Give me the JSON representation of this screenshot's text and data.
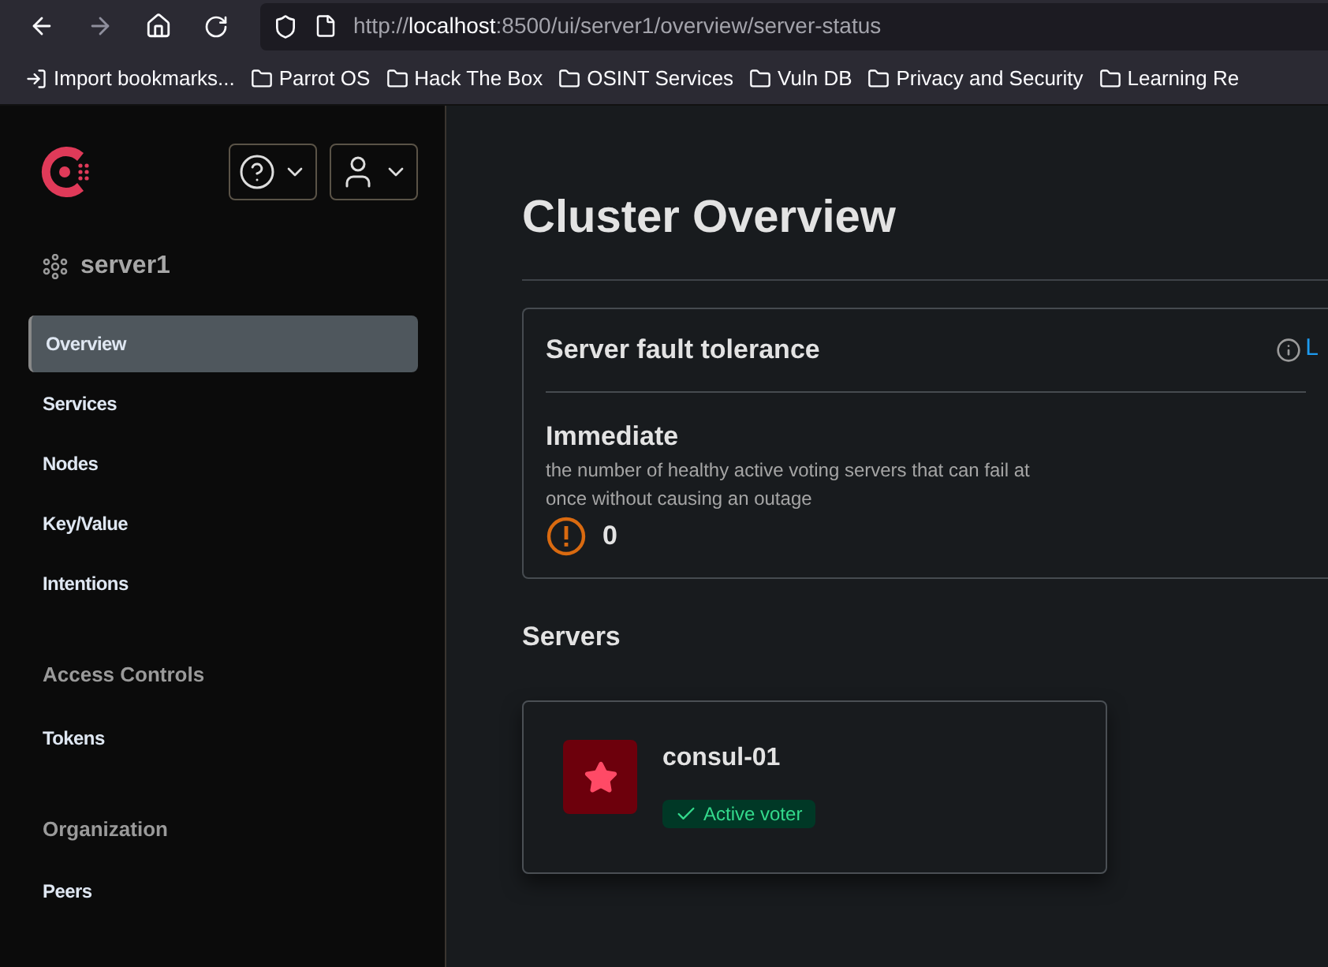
{
  "browser": {
    "url": {
      "scheme": "http://",
      "host": "localhost",
      "path": ":8500/ui/server1/overview/server-status"
    },
    "bookmarks": [
      {
        "kind": "import",
        "label": "Import bookmarks..."
      },
      {
        "kind": "folder",
        "label": "Parrot OS"
      },
      {
        "kind": "folder",
        "label": "Hack The Box"
      },
      {
        "kind": "folder",
        "label": "OSINT Services"
      },
      {
        "kind": "folder",
        "label": "Vuln DB"
      },
      {
        "kind": "folder",
        "label": "Privacy and Security"
      },
      {
        "kind": "folder",
        "label": "Learning Re"
      }
    ]
  },
  "sidebar": {
    "datacenter": "server1",
    "groups": [
      {
        "items": [
          {
            "label": "Overview",
            "selected": true
          },
          {
            "label": "Services",
            "selected": false
          },
          {
            "label": "Nodes",
            "selected": false
          },
          {
            "label": "Key/Value",
            "selected": false
          },
          {
            "label": "Intentions",
            "selected": false
          }
        ]
      },
      {
        "title": "Access Controls",
        "items": [
          {
            "label": "Tokens",
            "selected": false
          }
        ]
      },
      {
        "title": "Organization",
        "items": [
          {
            "label": "Peers",
            "selected": false
          }
        ]
      }
    ]
  },
  "main": {
    "title": "Cluster Overview",
    "fault_tolerance": {
      "heading": "Server fault tolerance",
      "link": "L",
      "subheading": "Immediate",
      "description": "the number of healthy active voting servers that can fail at once without causing an outage",
      "value": "0"
    },
    "servers_heading": "Servers",
    "servers": [
      {
        "name": "consul-01",
        "status": "Active voter"
      }
    ]
  }
}
